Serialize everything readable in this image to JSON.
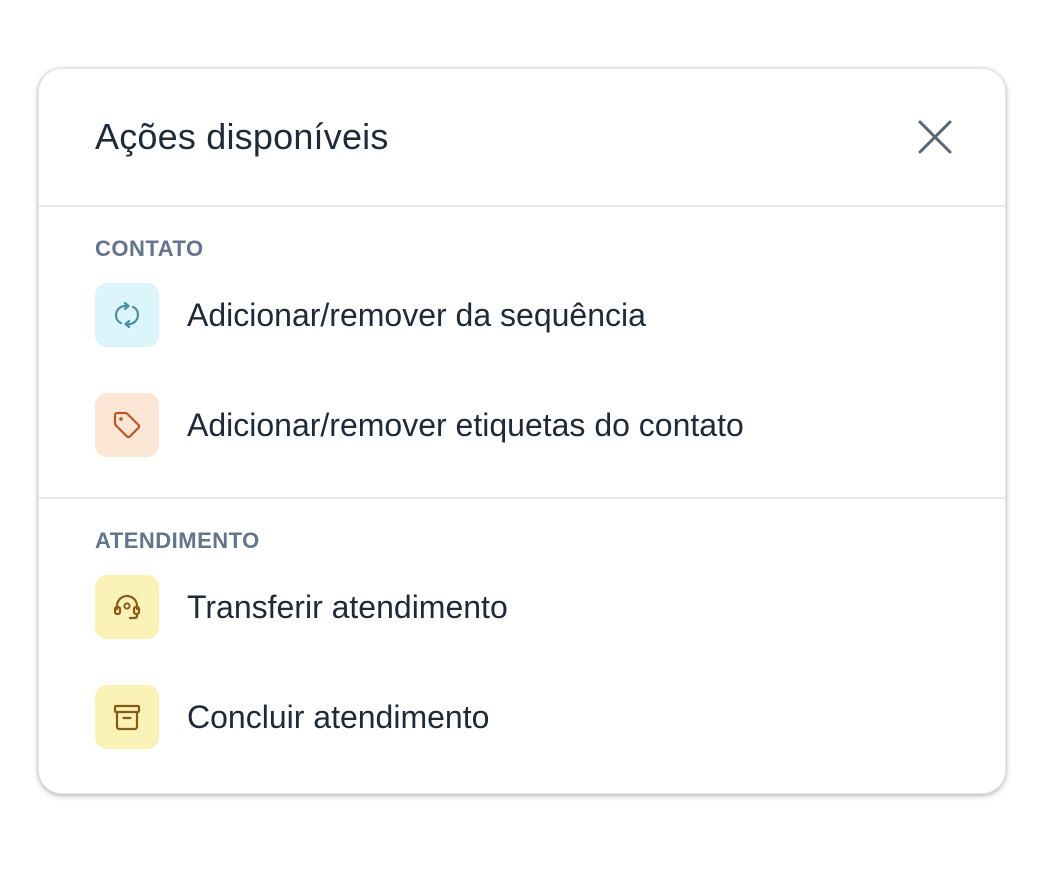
{
  "modal": {
    "title": "Ações disponíveis",
    "close_icon": "close-icon"
  },
  "sections": [
    {
      "label": "CONTATO",
      "items": [
        {
          "label": "Adicionar/remover da sequência",
          "icon": "sequence-icon",
          "icon_bg": "#dbf5fb",
          "icon_color": "#4b8fa5"
        },
        {
          "label": "Adicionar/remover etiquetas do contato",
          "icon": "tag-icon",
          "icon_bg": "#fbe6d6",
          "icon_color": "#b8562a"
        }
      ]
    },
    {
      "label": "ATENDIMENTO",
      "items": [
        {
          "label": "Transferir atendimento",
          "icon": "headset-icon",
          "icon_bg": "#fbf2b8",
          "icon_color": "#8a5a13"
        },
        {
          "label": "Concluir atendimento",
          "icon": "archive-icon",
          "icon_bg": "#fbf2b8",
          "icon_color": "#8a5a13"
        }
      ]
    }
  ]
}
